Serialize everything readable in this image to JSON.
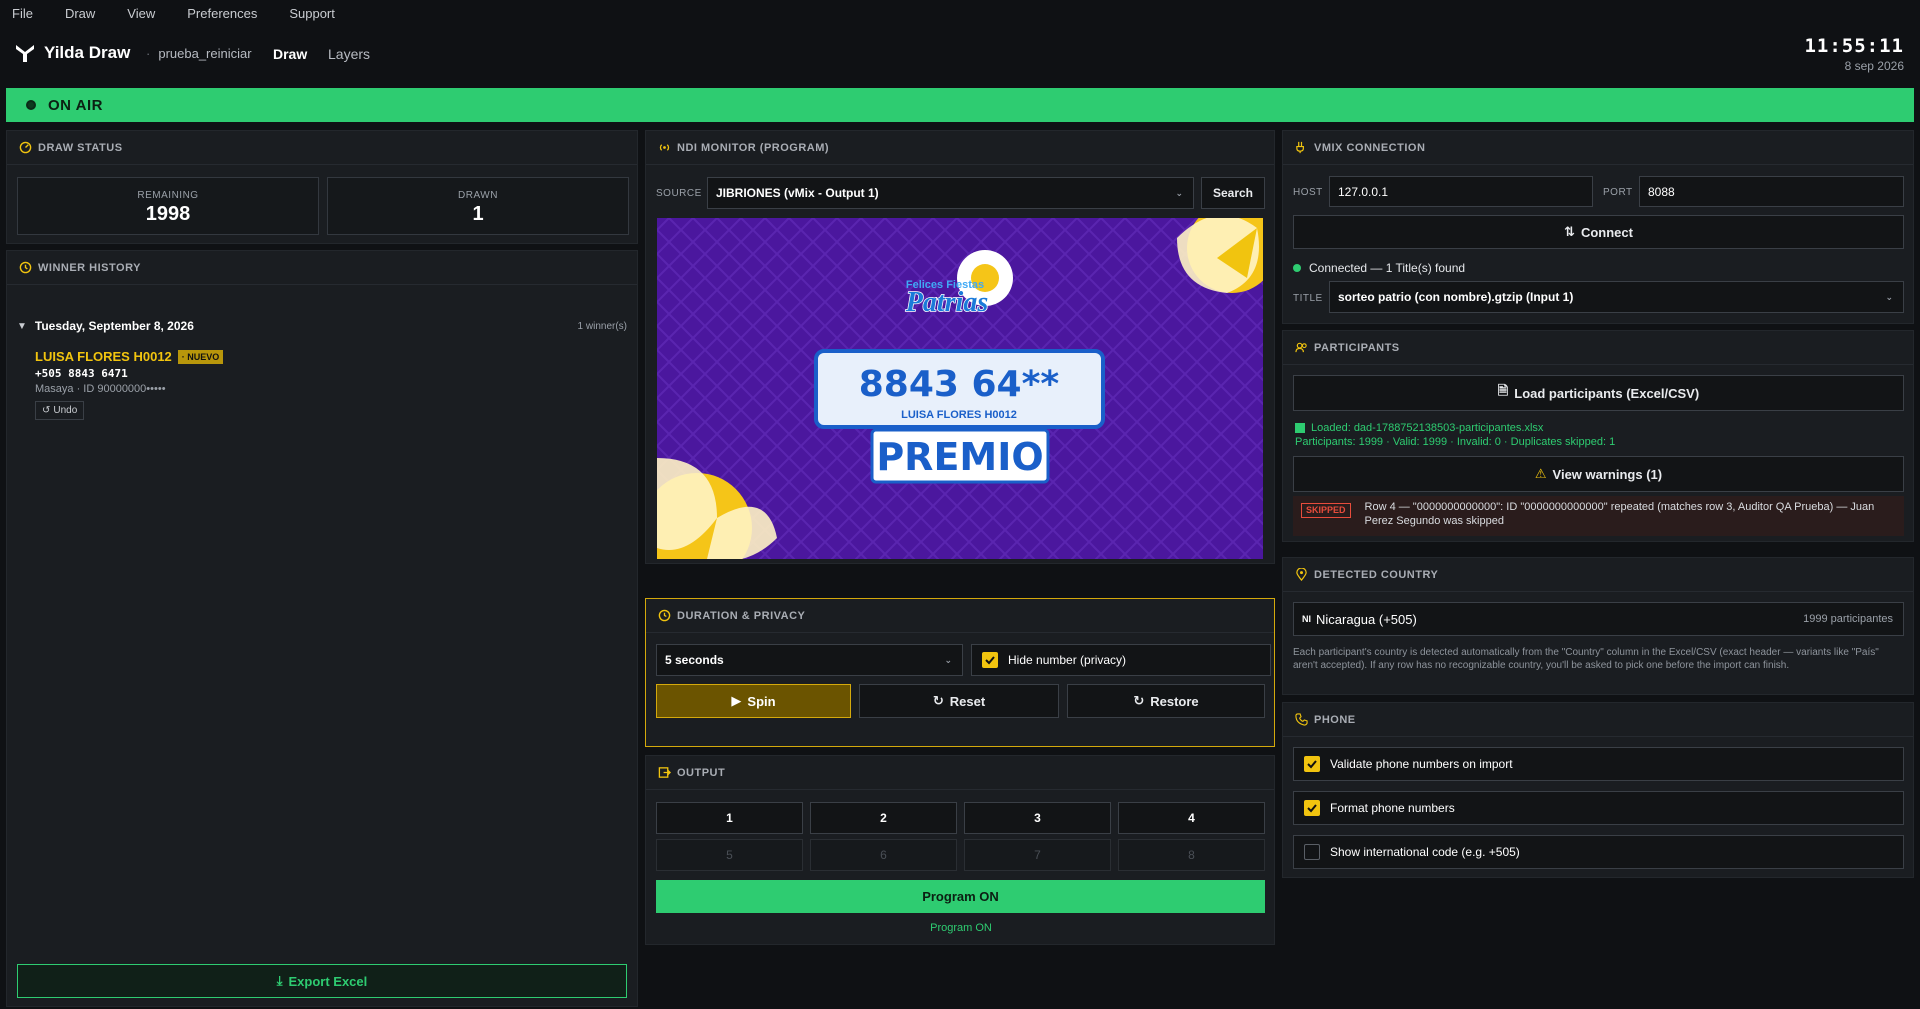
{
  "menu": [
    "File",
    "Draw",
    "View",
    "Preferences",
    "Support"
  ],
  "app": {
    "name": "Yilda Draw",
    "project": "prueba_reiniciar",
    "nav_draw": "Draw",
    "nav_layers": "Layers"
  },
  "clock": {
    "time": "11:55:11",
    "date": "8 sep 2026"
  },
  "onair": {
    "label": "ON AIR",
    "color": "#2ecc71"
  },
  "draw_status": {
    "title": "DRAW STATUS",
    "remaining_label": "REMAINING",
    "remaining": "1998",
    "drawn_label": "DRAWN",
    "drawn": "1"
  },
  "history": {
    "title": "WINNER HISTORY",
    "day": "Tuesday, September 8, 2026",
    "count": "1 winner(s)",
    "winner_name": "LUISA FLORES H0012",
    "badge": "· NUEVO",
    "phone": "+505 8843 6471",
    "detail": "Masaya · ID 90000000•••••",
    "undo": "Undo",
    "export": "Export Excel"
  },
  "ndi": {
    "title": "NDI MONITOR (PROGRAM)",
    "source_label": "SOURCE",
    "source_value": "JIBRIONES (vMix - Output 1)",
    "search": "Search",
    "preview": {
      "brand_top": "Felices Fiestas",
      "brand_main": "Patrias",
      "number": "8843 64**",
      "name": "LUISA FLORES H0012",
      "prize": "PREMIO"
    }
  },
  "duration": {
    "title": "DURATION & PRIVACY",
    "value": "5 seconds",
    "hide_label": "Hide number (privacy)",
    "hide_checked": true,
    "spin": "Spin",
    "reset": "Reset",
    "restore": "Restore"
  },
  "output": {
    "title": "OUTPUT",
    "buttons": [
      "1",
      "2",
      "3",
      "4",
      "5",
      "6",
      "7",
      "8"
    ],
    "program_button": "Program ON",
    "program_status": "Program ON"
  },
  "vmix": {
    "title": "VMIX CONNECTION",
    "host_label": "HOST",
    "host": "127.0.0.1",
    "port_label": "PORT",
    "port": "8088",
    "connect": "Connect",
    "status": "Connected — 1 Title(s) found",
    "title_label": "TITLE",
    "title_value": "sorteo patrio (con nombre).gtzip (Input 1)"
  },
  "participants": {
    "title": "PARTICIPANTS",
    "load": "Load participants (Excel/CSV)",
    "loaded": "Loaded: dad-1788752138503-participantes.xlsx",
    "stats": "Participants: 1999 · Valid: 1999 · Invalid: 0 · Duplicates skipped: 1",
    "warnings": "View warnings (1)",
    "skipped_badge": "SKIPPED",
    "warning_text": "Row 4 — \"0000000000000\": ID \"0000000000000\" repeated (matches row 3, Auditor QA Prueba) — Juan Perez Segundo was skipped"
  },
  "country": {
    "title": "DETECTED COUNTRY",
    "code": "NI",
    "name": "Nicaragua (+505)",
    "count": "1999 participantes",
    "note": "Each participant's country is detected automatically from the \"Country\" column in the Excel/CSV (exact header — variants like \"País\" aren't accepted). If any row has no recognizable country, you'll be asked to pick one before the import can finish."
  },
  "phone": {
    "title": "PHONE",
    "options": [
      {
        "label": "Validate phone numbers on import",
        "checked": true
      },
      {
        "label": "Format phone numbers",
        "checked": true
      },
      {
        "label": "Show international code (e.g. +505)",
        "checked": false
      }
    ]
  },
  "colors": {
    "accent": "#f1c40f",
    "green": "#2ecc71",
    "panel": "#1a1d21"
  },
  "icons": [
    "logo-icon",
    "gauge-icon",
    "history-icon",
    "broadcast-icon",
    "clock-icon",
    "output-icon",
    "plug-icon",
    "users-icon",
    "pin-icon",
    "phone-icon",
    "file-icon",
    "warning-icon",
    "play-icon",
    "reset-icon",
    "restore-icon",
    "download-icon",
    "undo-icon"
  ]
}
